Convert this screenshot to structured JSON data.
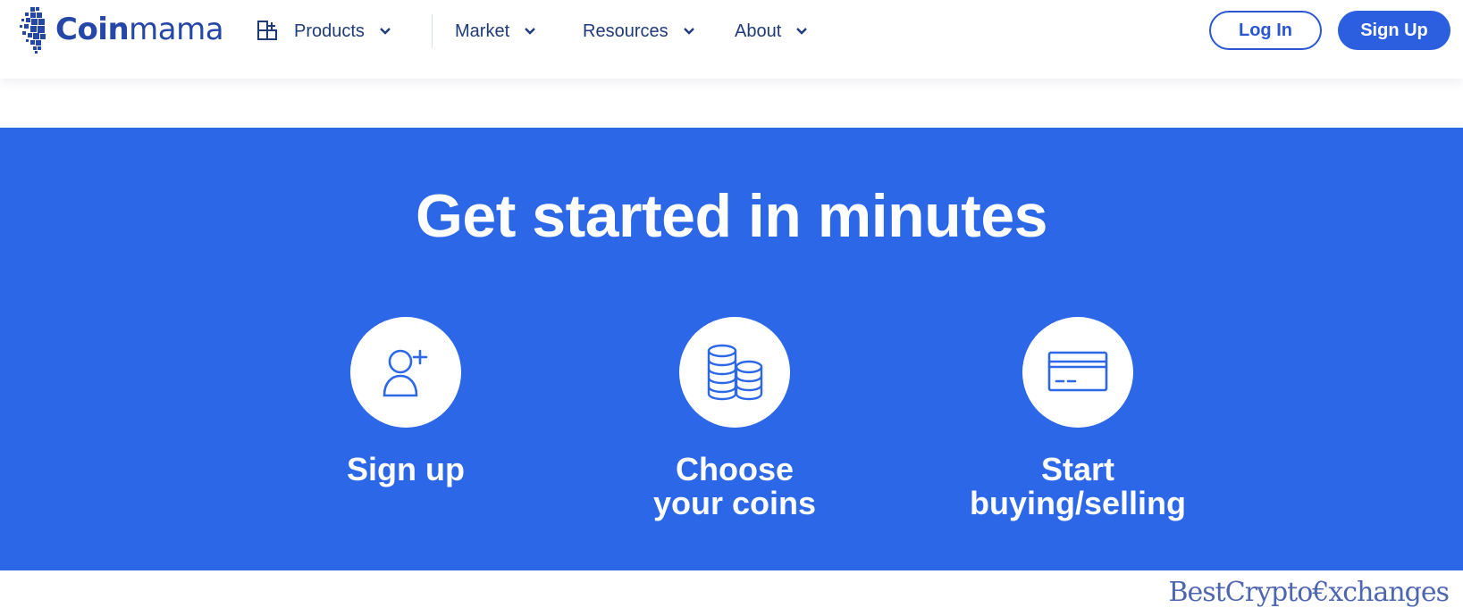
{
  "brand": {
    "name_bold": "Coin",
    "name_light": "mama",
    "color": "#2447a8"
  },
  "nav": {
    "items": [
      {
        "label": "Products",
        "icon": "grid-plus-icon"
      },
      {
        "label": "Market"
      },
      {
        "label": "Resources"
      },
      {
        "label": "About"
      }
    ]
  },
  "auth": {
    "login_label": "Log In",
    "signup_label": "Sign Up"
  },
  "hero": {
    "title": "Get started in minutes",
    "background": "#2c67e8",
    "steps": [
      {
        "label": "Sign up",
        "icon": "user-plus-icon"
      },
      {
        "label": "Choose\nyour coins",
        "icon": "coins-stack-icon"
      },
      {
        "label": "Start\nbuying/selling",
        "icon": "credit-card-icon"
      }
    ]
  },
  "watermark": {
    "text": "BestCrypto€xchanges"
  }
}
